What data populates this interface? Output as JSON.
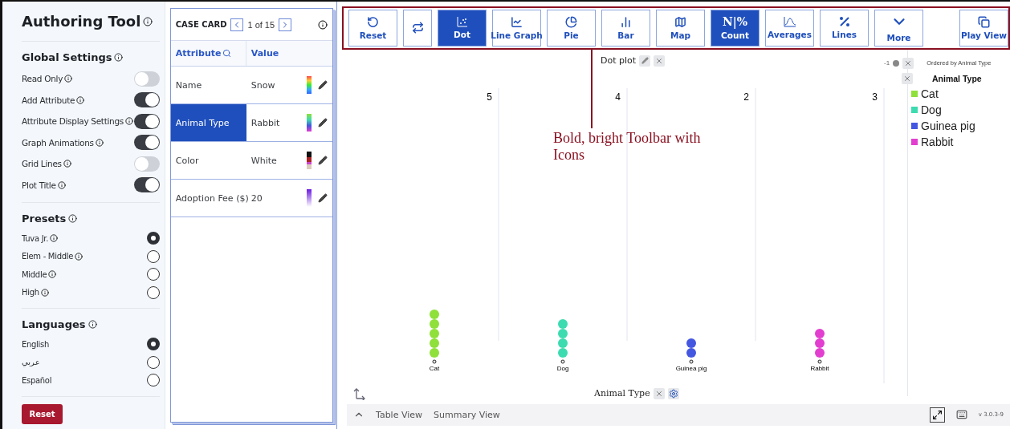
{
  "sidebar": {
    "title": "Authoring Tool",
    "sections": [
      {
        "title": "Global Settings",
        "kind": "toggles",
        "items": [
          {
            "label": "Read Only",
            "info": true,
            "on": false
          },
          {
            "label": "Add Attribute",
            "info": true,
            "on": true
          },
          {
            "label": "Attribute Display Settings",
            "info": true,
            "on": true
          },
          {
            "label": "Graph Animations",
            "info": true,
            "on": true
          },
          {
            "label": "Grid Lines",
            "info": true,
            "on": false
          },
          {
            "label": "Plot Title",
            "info": true,
            "on": true
          }
        ]
      },
      {
        "title": "Presets",
        "kind": "radios",
        "items": [
          {
            "label": "Tuva Jr.",
            "info": true,
            "selected": true
          },
          {
            "label": "Elem - Middle",
            "info": true,
            "selected": false
          },
          {
            "label": "Middle",
            "info": true,
            "selected": false
          },
          {
            "label": "High",
            "info": true,
            "selected": false
          }
        ]
      },
      {
        "title": "Languages",
        "kind": "radios",
        "items": [
          {
            "label": "English",
            "info": false,
            "selected": true
          },
          {
            "label": "عربي",
            "info": false,
            "selected": false
          },
          {
            "label": "Español",
            "info": false,
            "selected": false
          }
        ]
      }
    ],
    "reset_button": "Reset"
  },
  "case_card": {
    "title": "CASE CARD",
    "position": "1 of 15",
    "columns": [
      "Attribute",
      "Value"
    ],
    "rows": [
      {
        "attribute": "Name",
        "value": "Snow",
        "selected": false
      },
      {
        "attribute": "Animal Type",
        "value": "Rabbit",
        "selected": true
      },
      {
        "attribute": "Color",
        "value": "White",
        "selected": false
      },
      {
        "attribute": "Adoption Fee ($)",
        "value": "20",
        "selected": false
      }
    ]
  },
  "toolbar": [
    {
      "kind": "reset",
      "label": "Reset",
      "selected": false
    },
    {
      "kind": "swap",
      "selected": false
    },
    {
      "kind": "dot",
      "label": "Dot",
      "selected": true
    },
    {
      "kind": "line",
      "label": "Line Graph",
      "selected": false
    },
    {
      "kind": "pie",
      "label": "Pie",
      "selected": false
    },
    {
      "kind": "bar",
      "label": "Bar",
      "selected": false
    },
    {
      "kind": "map",
      "label": "Map",
      "selected": false
    },
    {
      "kind": "count",
      "label": "Count",
      "glyph": "N|%",
      "selected": true
    },
    {
      "kind": "averages",
      "label": "Averages",
      "selected": false
    },
    {
      "kind": "lines",
      "label": "Lines",
      "selected": false
    },
    {
      "kind": "more",
      "label": "More",
      "selected": false
    },
    {
      "kind": "play",
      "label": "Play View",
      "selected": false
    }
  ],
  "annotation": "Bold, bright Toolbar with Icons",
  "graph": {
    "title": "Dot plot",
    "filter_value": "-1",
    "order_note": "Ordered by Animal Type",
    "axis_label": "Animal Type",
    "columns": [
      {
        "label": "Cat",
        "count": "5",
        "dots": [
          {
            "color": "#8fe03a"
          },
          {
            "color": "#8fe03a"
          },
          {
            "color": "#8fe03a"
          },
          {
            "color": "#8fe03a"
          },
          {
            "color": "#8fe03a"
          }
        ]
      },
      {
        "label": "Dog",
        "count": "4",
        "dots": [
          {
            "color": "#3ddbb0"
          },
          {
            "color": "#3ddbb0"
          },
          {
            "color": "#3ddbb0"
          },
          {
            "color": "#3ddbb0"
          }
        ]
      },
      {
        "label": "Guinea pig",
        "count": "2",
        "dots": [
          {
            "color": "#4457e0"
          },
          {
            "color": "#4457e0"
          }
        ]
      },
      {
        "label": "Rabbit",
        "count": "3",
        "dots": [
          {
            "color": "#e23ecf"
          },
          {
            "color": "#e23ecf"
          },
          {
            "color": "#e23ecf"
          }
        ]
      }
    ],
    "legend": {
      "title": "Animal Type",
      "items": [
        {
          "label": "Cat",
          "color": "#8fe03a"
        },
        {
          "label": "Dog",
          "color": "#3ddbb0"
        },
        {
          "label": "Guinea pig",
          "color": "#4457e0"
        },
        {
          "label": "Rabbit",
          "color": "#e23ecf"
        }
      ]
    }
  },
  "bottom_bar": {
    "tabs": [
      "Table View",
      "Summary View"
    ],
    "version": "v 3.0.3-9"
  }
}
